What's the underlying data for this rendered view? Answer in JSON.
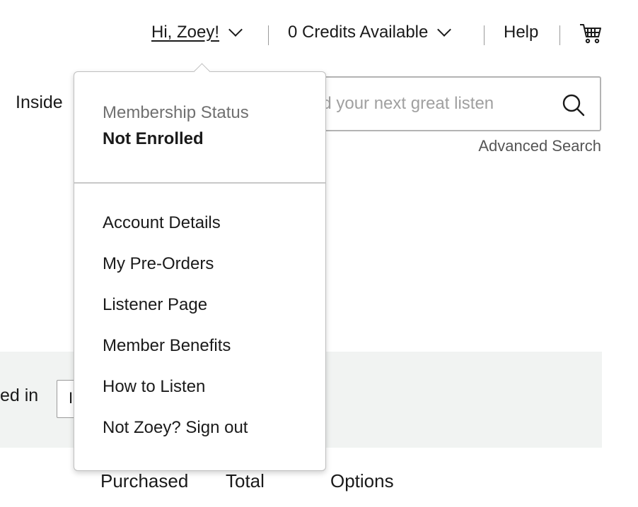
{
  "top_nav": {
    "greeting": "Hi, Zoey!",
    "credits": "0 Credits Available",
    "help": "Help"
  },
  "page": {
    "inside_text": "Inside",
    "search": {
      "placeholder": "Find your next great listen",
      "advanced_label": "Advanced Search"
    },
    "band_text": "ed in",
    "band_select_value": "I",
    "columns": [
      "Purchased",
      "Total",
      "Options"
    ]
  },
  "account_dropdown": {
    "membership_label": "Membership Status",
    "membership_value": "Not Enrolled",
    "items": [
      {
        "label": "Account Details"
      },
      {
        "label": "My Pre-Orders"
      },
      {
        "label": "Listener Page"
      },
      {
        "label": "Member Benefits"
      },
      {
        "label": "How to Listen"
      },
      {
        "label": "Not Zoey? Sign out"
      }
    ]
  },
  "icons": {
    "greeting_chevron": "chevron-down-icon",
    "credits_chevron": "chevron-down-icon",
    "cart": "cart-icon",
    "search": "search-icon"
  },
  "colors": {
    "band_background": "#f1f3f2",
    "muted_text": "#707070"
  }
}
